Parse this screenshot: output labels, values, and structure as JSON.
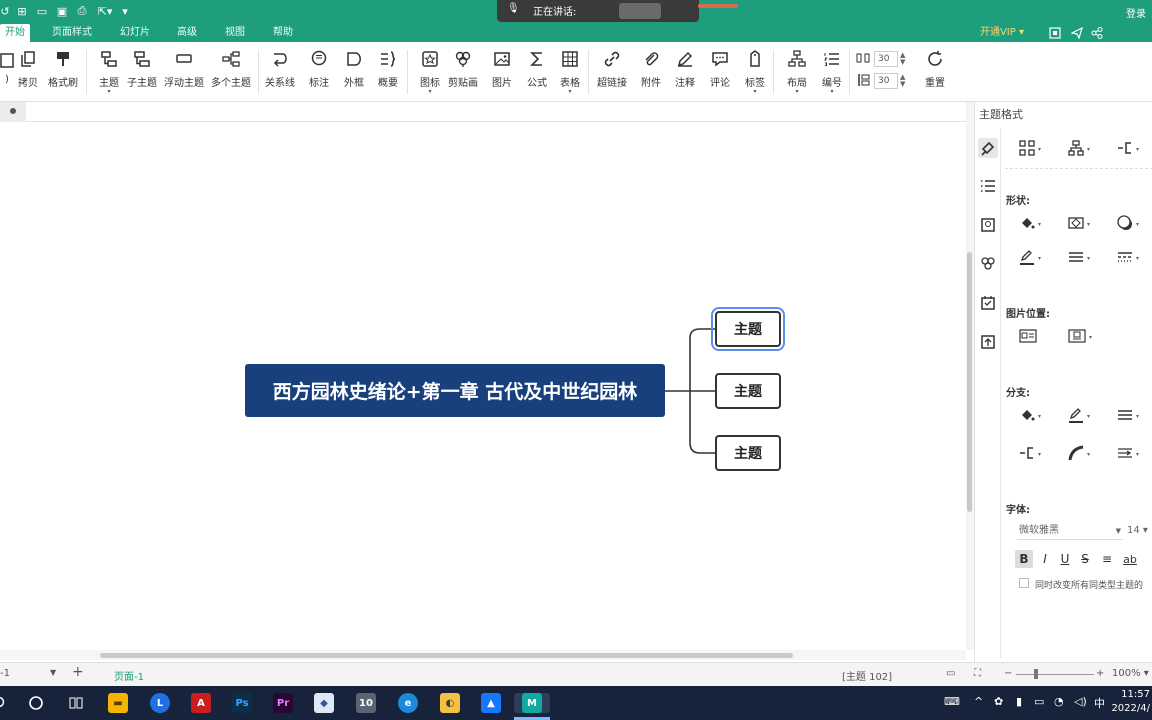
{
  "titlebar": {
    "login": "登录"
  },
  "tabs": [
    {
      "label": "开始",
      "active": true
    },
    {
      "label": "页面样式"
    },
    {
      "label": "幻灯片"
    },
    {
      "label": "高级"
    },
    {
      "label": "视图"
    },
    {
      "label": "帮助"
    }
  ],
  "vip_label": "开通VIP",
  "speaking": {
    "label": "正在讲话:"
  },
  "ribbon": {
    "buttons": [
      {
        "label": "拷贝",
        "icon": "copy-icon"
      },
      {
        "label": "格式刷",
        "icon": "format-painter-icon"
      },
      {
        "label": "主题",
        "icon": "topic-icon"
      },
      {
        "label": "子主题",
        "icon": "subtopic-icon"
      },
      {
        "label": "浮动主题",
        "icon": "floating-topic-icon"
      },
      {
        "label": "多个主题",
        "icon": "multiple-topics-icon"
      },
      {
        "label": "关系线",
        "icon": "relationship-icon"
      },
      {
        "label": "标注",
        "icon": "callout-icon"
      },
      {
        "label": "外框",
        "icon": "boundary-icon"
      },
      {
        "label": "概要",
        "icon": "summary-icon"
      },
      {
        "label": "图标",
        "icon": "sticker-icon"
      },
      {
        "label": "剪贴画",
        "icon": "clipart-icon"
      },
      {
        "label": "图片",
        "icon": "image-icon"
      },
      {
        "label": "公式",
        "icon": "formula-icon"
      },
      {
        "label": "表格",
        "icon": "table-icon"
      },
      {
        "label": "超链接",
        "icon": "hyperlink-icon"
      },
      {
        "label": "附件",
        "icon": "attachment-icon"
      },
      {
        "label": "注释",
        "icon": "note-icon"
      },
      {
        "label": "评论",
        "icon": "comment-icon"
      },
      {
        "label": "标签",
        "icon": "tag-icon"
      },
      {
        "label": "布局",
        "icon": "layout-icon"
      },
      {
        "label": "编号",
        "icon": "numbering-icon"
      },
      {
        "label": "重置",
        "icon": "reset-icon"
      }
    ],
    "spacing_h": "30",
    "spacing_v": "30"
  },
  "map": {
    "central": "西方园林史绪论+第一章 古代及中世纪园林",
    "topics": [
      "主题",
      "主题",
      "主题"
    ]
  },
  "panel": {
    "title": "主题格式",
    "shape_label": "形状:",
    "image_pos_label": "图片位置:",
    "branch_label": "分支:",
    "font_label": "字体:",
    "font_name": "微软雅黑",
    "font_size": "14",
    "apply_all_label": "同时改变所有同类型主题的"
  },
  "status": {
    "page_selector": "-1",
    "page_tab": "页面-1",
    "topic_info": "[主题 102]",
    "zoom": "100%"
  },
  "taskbar": {
    "time": "11:57",
    "date": "2022/4/",
    "ime": "中"
  }
}
